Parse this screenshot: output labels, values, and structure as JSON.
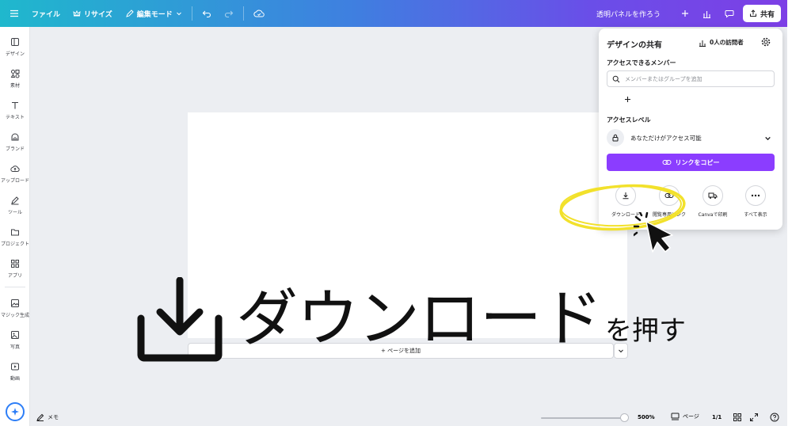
{
  "topbar": {
    "menu_icon": "hamburger-icon",
    "file_label": "ファイル",
    "resize_label": "リサイズ",
    "edit_mode_label": "編集モード",
    "title": "透明パネルを作ろう",
    "share_label": "共有"
  },
  "sidebar": {
    "items": [
      {
        "label": "デザイン",
        "icon": "design-icon"
      },
      {
        "label": "素材",
        "icon": "elements-icon"
      },
      {
        "label": "テキスト",
        "icon": "text-icon"
      },
      {
        "label": "ブランド",
        "icon": "brand-icon"
      },
      {
        "label": "アップロード",
        "icon": "upload-icon"
      },
      {
        "label": "ツール",
        "icon": "pen-icon"
      },
      {
        "label": "プロジェクト",
        "icon": "folder-icon"
      },
      {
        "label": "アプリ",
        "icon": "apps-icon"
      },
      {
        "label": "マジック生成",
        "icon": "image-icon"
      },
      {
        "label": "写真",
        "icon": "photo-icon"
      },
      {
        "label": "動画",
        "icon": "video-icon"
      }
    ]
  },
  "share_panel": {
    "title": "デザインの共有",
    "visitors": "0人の訪問者",
    "members_heading": "アクセスできるメンバー",
    "search_placeholder": "メンバーまたはグループを追加",
    "access_heading": "アクセスレベル",
    "access_level": "あなただけがアクセス可能",
    "copy_link": "リンクをコピー",
    "options": [
      {
        "label": "ダウンロード",
        "icon": "download-icon"
      },
      {
        "label": "閲覧専用リンク",
        "icon": "link-icon"
      },
      {
        "label": "Canvaで印刷",
        "icon": "truck-icon"
      },
      {
        "label": "すべて表示",
        "icon": "more-icon"
      }
    ]
  },
  "canvas": {
    "add_page": "+ ページを追加"
  },
  "overlay": {
    "big_text": "ダウンロード",
    "small_text": "を押す"
  },
  "bottombar": {
    "memo": "メモ",
    "zoom": "500%",
    "zoom_fraction": 0.95,
    "pages_label": "ページ",
    "page_count": "1/1"
  },
  "colors": {
    "accent": "#8b3dff",
    "highlight": "#f2e12b",
    "magic_border": "#2d7ef7"
  }
}
